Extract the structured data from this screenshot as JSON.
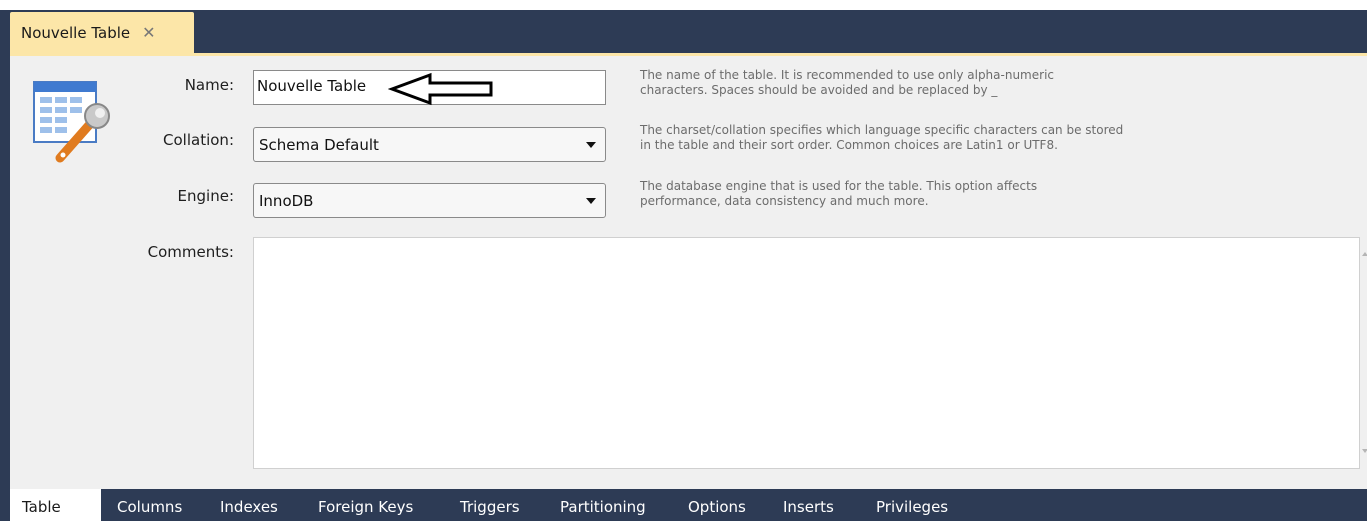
{
  "tab": {
    "title": "Nouvelle Table",
    "close_glyph": "✕"
  },
  "form": {
    "name_label": "Name:",
    "name_value": "Nouvelle Table",
    "name_hint_1": "The name of the table. It is recommended to use only alpha-numeric",
    "name_hint_2": "characters. Spaces should be avoided and be replaced by _",
    "collation_label": "Collation:",
    "collation_value": "Schema Default",
    "collation_hint_1": "The charset/collation specifies which language specific characters can be stored",
    "collation_hint_2": "in the table and their sort order. Common choices are Latin1 or UTF8.",
    "engine_label": "Engine:",
    "engine_value": "InnoDB",
    "engine_hint_1": "The database engine that is used for the table. This option affects",
    "engine_hint_2": "performance, data consistency and much more.",
    "comments_label": "Comments:",
    "comments_value": ""
  },
  "bottom_tabs": [
    "Table",
    "Columns",
    "Indexes",
    "Foreign Keys",
    "Triggers",
    "Partitioning",
    "Options",
    "Inserts",
    "Privileges"
  ],
  "active_bottom_tab": "Table",
  "icons": {
    "table": "table-settings-icon",
    "annotation": "arrow-annotation-icon",
    "close": "close-icon",
    "dropdown": "chevron-down-icon"
  },
  "colors": {
    "frame": "#2d3b55",
    "tab_active": "#fce6a8",
    "panel": "#f0f0f0",
    "hint_text": "#6c6c6c"
  }
}
